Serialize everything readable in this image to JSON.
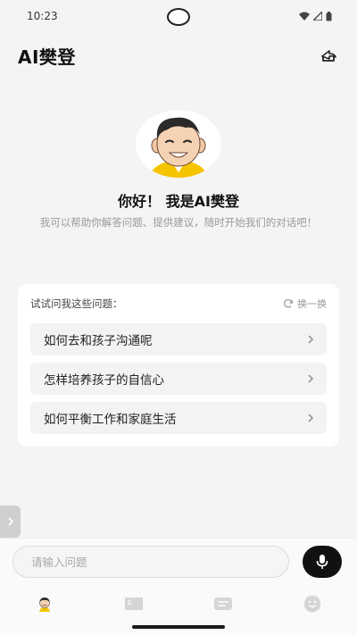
{
  "status_bar": {
    "time": "10:23"
  },
  "header": {
    "title": "AI樊登",
    "action_icon": "share-icon"
  },
  "welcome": {
    "greeting": "你好！ 我是AI樊登",
    "intro": "我可以帮助你解答问题、提供建议，随时开始我们的对话吧！"
  },
  "suggestions": {
    "title": "试试问我这些问题：",
    "refresh_label": "换一换",
    "items": [
      {
        "label": "如何去和孩子沟通呢"
      },
      {
        "label": "怎样培养孩子的自信心"
      },
      {
        "label": "如何平衡工作和家庭生活"
      }
    ]
  },
  "input": {
    "placeholder": "请输入问题"
  },
  "tabs": [
    {
      "icon": "avatar-icon"
    },
    {
      "icon": "book-icon"
    },
    {
      "icon": "chat-icon"
    },
    {
      "icon": "smile-icon"
    }
  ],
  "colors": {
    "accent": "#111111",
    "background": "#f4f4f4",
    "card": "#ffffff",
    "muted_text": "#999999",
    "avatar_shirt": "#f5c400"
  }
}
